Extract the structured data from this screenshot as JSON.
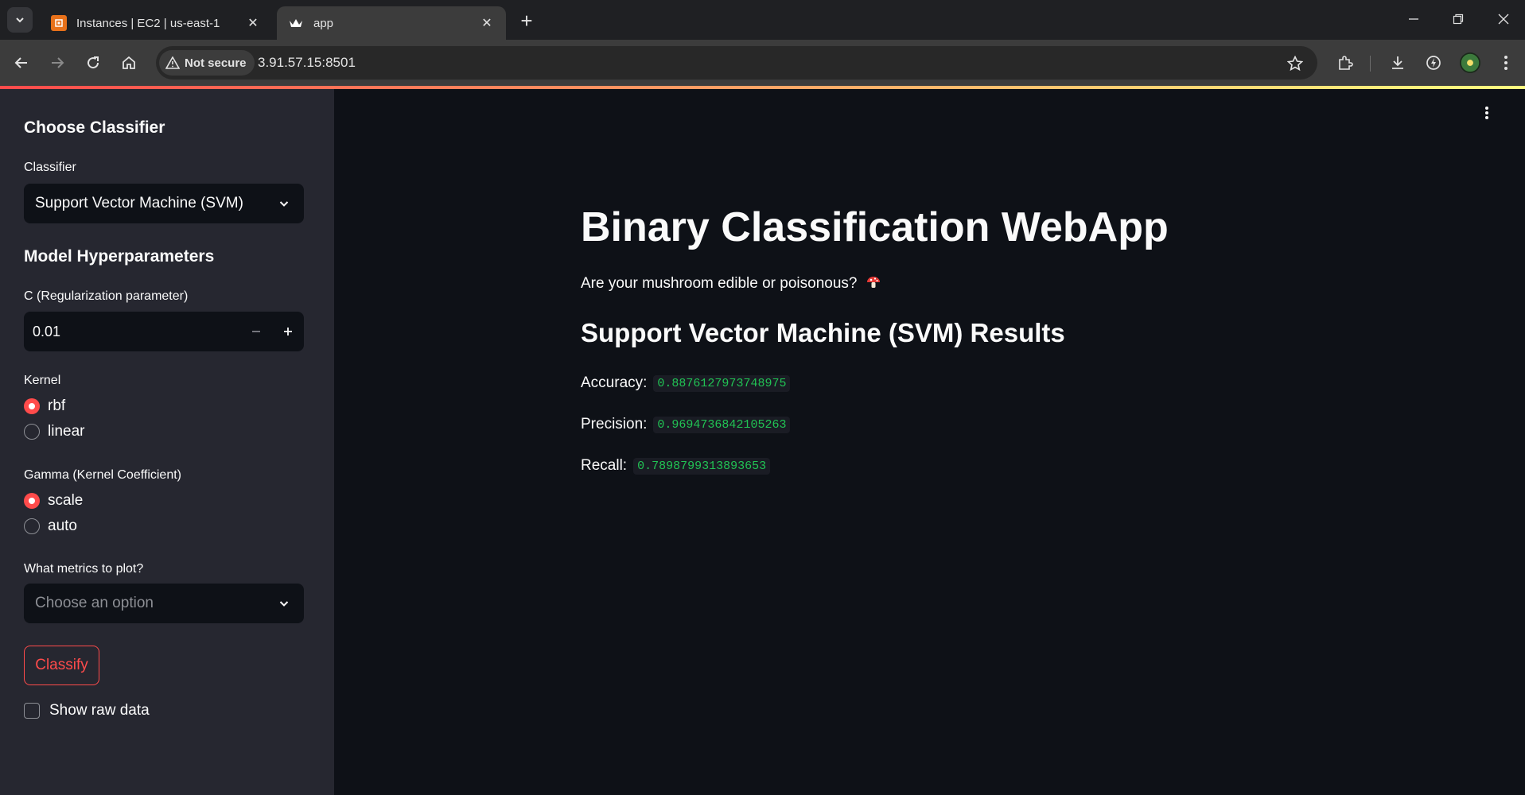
{
  "browser": {
    "tabs": [
      {
        "title": "Instances | EC2 | us-east-1",
        "active": false,
        "icon": "aws-ec2-icon"
      },
      {
        "title": "app",
        "active": true,
        "icon": "streamlit-crown-icon"
      }
    ],
    "security_label": "Not secure",
    "url": "3.91.57.15:8501"
  },
  "sidebar": {
    "choose_classifier_heading": "Choose Classifier",
    "classifier_label": "Classifier",
    "classifier_value": "Support Vector Machine (SVM)",
    "hyperparams_heading": "Model Hyperparameters",
    "c_label": "C (Regularization parameter)",
    "c_value": "0.01",
    "kernel_label": "Kernel",
    "kernel_options": [
      "rbf",
      "linear"
    ],
    "kernel_selected": "rbf",
    "gamma_label": "Gamma (Kernel Coefficient)",
    "gamma_options": [
      "scale",
      "auto"
    ],
    "gamma_selected": "scale",
    "metrics_label": "What metrics to plot?",
    "metrics_placeholder": "Choose an option",
    "classify_button": "Classify",
    "show_raw_data_label": "Show raw data"
  },
  "main": {
    "title": "Binary Classification WebApp",
    "subtitle": "Are your mushroom edible or poisonous?",
    "results_heading": "Support Vector Machine (SVM) Results",
    "metrics": [
      {
        "label": "Accuracy:",
        "value": "0.8876127973748975"
      },
      {
        "label": "Precision:",
        "value": "0.9694736842105263"
      },
      {
        "label": "Recall:",
        "value": "0.7898799313893653"
      }
    ]
  },
  "colors": {
    "primary": "#ff4b4b",
    "app_bg": "#0e1117",
    "sidebar_bg": "#262730",
    "code_green": "#21c354"
  }
}
